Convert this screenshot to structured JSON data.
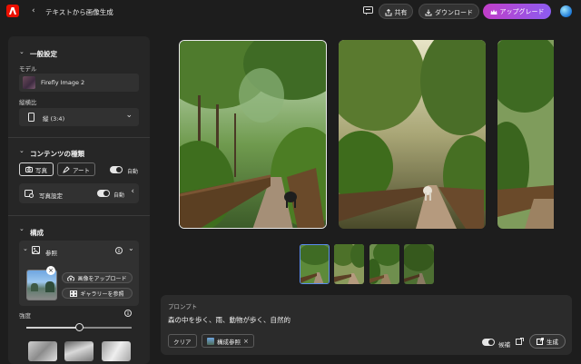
{
  "header": {
    "title": "テキストから画像生成",
    "share": "共有",
    "download": "ダウンロード",
    "upgrade": "アップグレード"
  },
  "general": {
    "title": "一般設定",
    "model_label": "モデル",
    "model_value": "Firefly Image 2",
    "aspect_label": "縦横比",
    "aspect_value": "縦 (3:4)"
  },
  "content_type": {
    "title": "コンテンツの種類",
    "photo": "写真",
    "art": "アート",
    "auto": "自動",
    "photo_settings": "写真設定",
    "photo_settings_auto": "自動"
  },
  "composition": {
    "title": "構成",
    "reference": "参照",
    "upload": "画像をアップロード",
    "gallery": "ギャラリーを参照",
    "strength": "強度",
    "strength_level": 0.5
  },
  "prompt": {
    "label": "プロンプト",
    "text": "森の中を歩く、雨、動物が歩く、自然的",
    "clear": "クリア",
    "comp_ref": "構成参照",
    "candidates": "候補",
    "generate": "生成"
  },
  "colors": {
    "accent_logo": "#eb1000",
    "upgrade_start": "#c13ec8",
    "upgrade_end": "#8c5cf0",
    "selected_thumb": "#5b8def"
  }
}
